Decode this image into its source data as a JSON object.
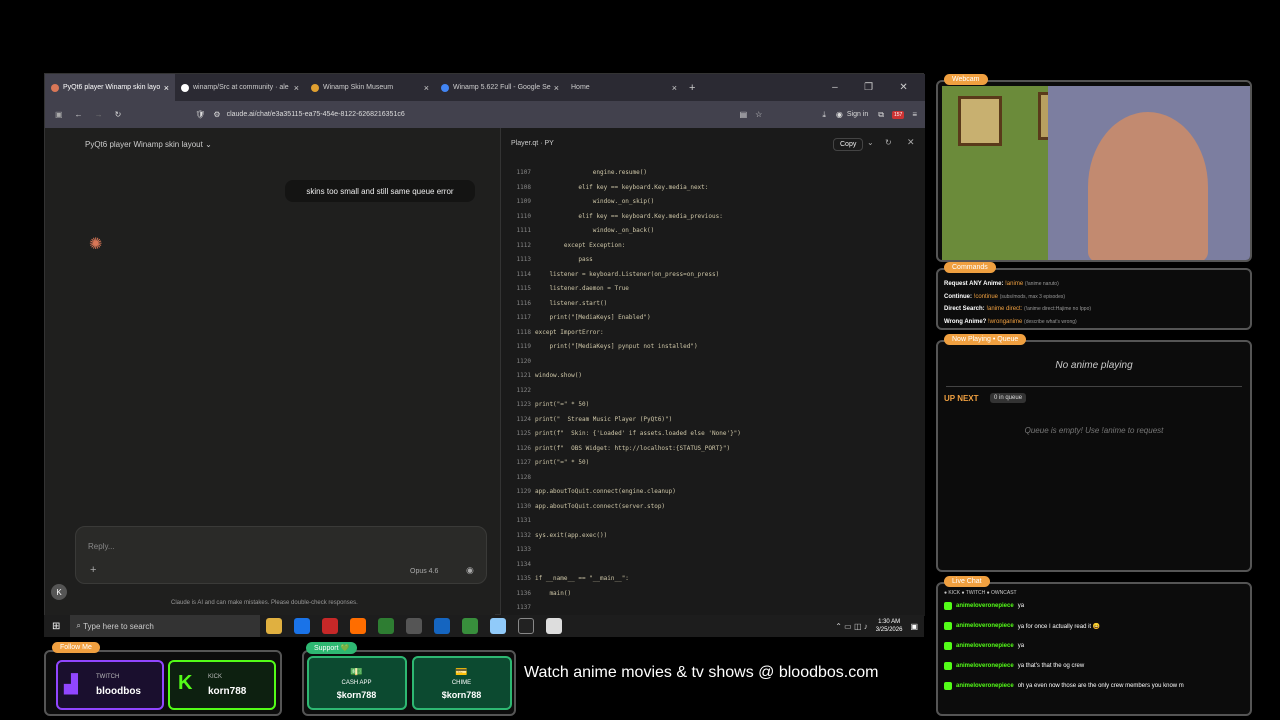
{
  "browser": {
    "tabs": [
      {
        "label": "PyQt6 player Winamp skin layo",
        "active": true,
        "color": "#d97757"
      },
      {
        "label": "winamp/Src at community · ale",
        "active": false,
        "color": "#ffffff"
      },
      {
        "label": "Winamp Skin Museum",
        "active": false,
        "color": "#e0a030"
      },
      {
        "label": "Winamp 5.622 Full - Google Se",
        "active": false,
        "color": "#4285f4"
      },
      {
        "label": "Home",
        "active": false,
        "color": "#888888"
      }
    ],
    "url": "claude.ai/chat/e3a35115-ea75-454e-8122-6268216351c6",
    "signin": "Sign in",
    "badge": "157"
  },
  "chat": {
    "title": "PyQt6 player Winamp skin layout",
    "user_message": "skins too small and still same queue error",
    "reply_placeholder": "Reply...",
    "model": "Opus 4.6",
    "disclaimer": "Claude is AI and can make mistakes. Please double-check responses.",
    "avatar": "K"
  },
  "code": {
    "filename": "Player.qt",
    "ext": "PY",
    "copy": "Copy",
    "lines": [
      {
        "n": "1107",
        "t": "                engine.resume()"
      },
      {
        "n": "1108",
        "t": "            elif key == keyboard.Key.media_next:"
      },
      {
        "n": "1109",
        "t": "                window._on_skip()"
      },
      {
        "n": "1110",
        "t": "            elif key == keyboard.Key.media_previous:"
      },
      {
        "n": "1111",
        "t": "                window._on_back()"
      },
      {
        "n": "1112",
        "t": "        except Exception:"
      },
      {
        "n": "1113",
        "t": "            pass"
      },
      {
        "n": "1114",
        "t": "    listener = keyboard.Listener(on_press=on_press)"
      },
      {
        "n": "1115",
        "t": "    listener.daemon = True"
      },
      {
        "n": "1116",
        "t": "    listener.start()"
      },
      {
        "n": "1117",
        "t": "    print(\"[MediaKeys] Enabled\")"
      },
      {
        "n": "1118",
        "t": "except ImportError:"
      },
      {
        "n": "1119",
        "t": "    print(\"[MediaKeys] pynput not installed\")"
      },
      {
        "n": "1120",
        "t": ""
      },
      {
        "n": "1121",
        "t": "window.show()"
      },
      {
        "n": "1122",
        "t": ""
      },
      {
        "n": "1123",
        "t": "print(\"=\" * 50)"
      },
      {
        "n": "1124",
        "t": "print(\"  Stream Music Player (PyQt6)\")"
      },
      {
        "n": "1125",
        "t": "print(f\"  Skin: {'Loaded' if assets.loaded else 'None'}\")"
      },
      {
        "n": "1126",
        "t": "print(f\"  OBS Widget: http://localhost:{STATUS_PORT}\")"
      },
      {
        "n": "1127",
        "t": "print(\"=\" * 50)"
      },
      {
        "n": "1128",
        "t": ""
      },
      {
        "n": "1129",
        "t": "app.aboutToQuit.connect(engine.cleanup)"
      },
      {
        "n": "1130",
        "t": "app.aboutToQuit.connect(server.stop)"
      },
      {
        "n": "1131",
        "t": ""
      },
      {
        "n": "1132",
        "t": "sys.exit(app.exec())"
      },
      {
        "n": "1133",
        "t": ""
      },
      {
        "n": "1134",
        "t": ""
      },
      {
        "n": "1135",
        "t": "if __name__ == \"__main__\":"
      },
      {
        "n": "1136",
        "t": "    main()"
      },
      {
        "n": "1137",
        "t": ""
      }
    ]
  },
  "taskbar": {
    "search": "Type here to search",
    "time": "1:30 AM",
    "date": "3/25/2026"
  },
  "overlay": {
    "webcam": "Webcam",
    "commands_title": "Commands",
    "commands": [
      {
        "label": "Request ANY Anime:",
        "cmd": "!anime",
        "desc": "(!anime naruto)"
      },
      {
        "label": "Continue:",
        "cmd": "!continue",
        "desc": "(subs/mods, max 3 episodes)"
      },
      {
        "label": "Direct Search:",
        "cmd": "!anime direct:",
        "desc": "(!anime direct:Hajime no Ippo)"
      },
      {
        "label": "Wrong Anime?",
        "cmd": "!wronganime",
        "desc": "(describe what's wrong)"
      }
    ],
    "now_playing_title": "Now Playing • Queue",
    "no_anime": "No anime playing",
    "up_next": "UP NEXT",
    "queue_count": "0 in queue",
    "queue_empty": "Queue is empty! Use !anime to request",
    "live_chat_title": "Live Chat",
    "platforms": "● KICK  ● TWITCH  ● OWNCAST",
    "chat": [
      {
        "user": "animeloveronepiece",
        "msg": "ya"
      },
      {
        "user": "animeloveronepiece",
        "msg": "ya for once I actually read it 😄"
      },
      {
        "user": "animeloveronepiece",
        "msg": "ya"
      },
      {
        "user": "animeloveronepiece",
        "msg": "ya that's that the og crew"
      },
      {
        "user": "animeloveronepiece",
        "msg": "oh ya even now those are the only crew members you know m"
      }
    ],
    "follow_title": "Follow Me",
    "twitch": {
      "platform": "TWITCH",
      "name": "bloodbos"
    },
    "kick": {
      "platform": "KICK",
      "name": "korn788"
    },
    "support_title": "Support 💚",
    "cashapp": {
      "label": "CASH APP",
      "tag": "$korn788"
    },
    "chime": {
      "label": "CHIME",
      "tag": "$korn788"
    },
    "banner": "Watch anime movies & tv shows @ bloodbos.com"
  },
  "colors": {
    "accent": "#f0a040",
    "kick": "#53fc18",
    "claude": "#d97757"
  }
}
